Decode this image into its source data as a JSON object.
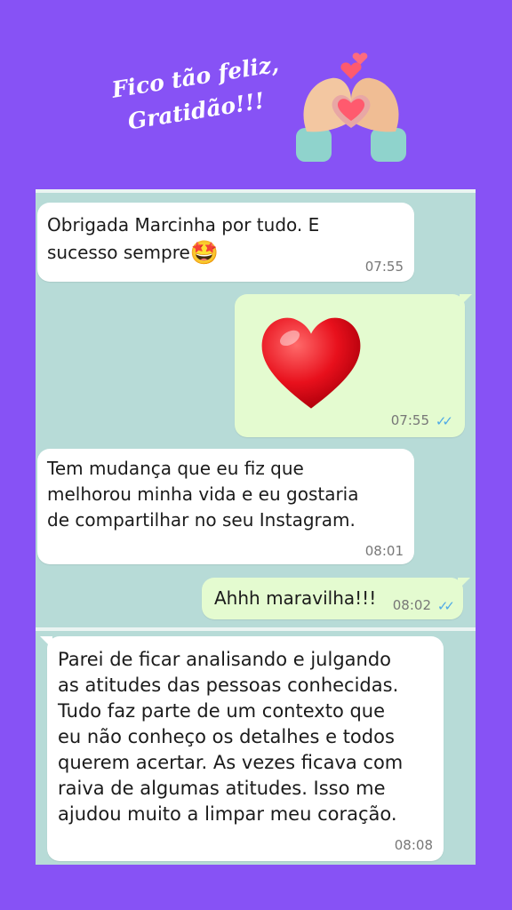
{
  "caption": {
    "line1": "Fico tão feliz,",
    "line2": "Gratidão!!!"
  },
  "decor_icon": "heart-hands-icon",
  "colors": {
    "background": "#8752f5",
    "chat_wallpaper": "#b7dbd7",
    "incoming_bubble": "#ffffff",
    "outgoing_bubble": "#e4fbd0",
    "read_ticks": "#4fa9e6"
  },
  "messages": [
    {
      "direction": "incoming",
      "text": "Obrigada Marcinha por tudo. E\nsucesso sempre",
      "emoji": "🤩",
      "time": "07:55"
    },
    {
      "direction": "outgoing",
      "emoji": "❤️",
      "time": "07:55",
      "status": "read"
    },
    {
      "direction": "incoming",
      "text": "Tem mudança que eu fiz que\nmelhorou minha vida e eu gostaria\nde compartilhar no seu Instagram.",
      "time": "08:01"
    },
    {
      "direction": "outgoing",
      "text": "Ahhh maravilha!!!",
      "time": "08:02",
      "status": "read"
    },
    {
      "direction": "incoming",
      "text": "Parei de ficar analisando e julgando\nas atitudes das pessoas conhecidas.\nTudo faz parte de um contexto que\neu não conheço os detalhes e todos\nquerem acertar. As vezes ficava com\nraiva de algumas atitudes. Isso me\najudou muito a limpar meu coração.",
      "time": "08:08"
    }
  ]
}
